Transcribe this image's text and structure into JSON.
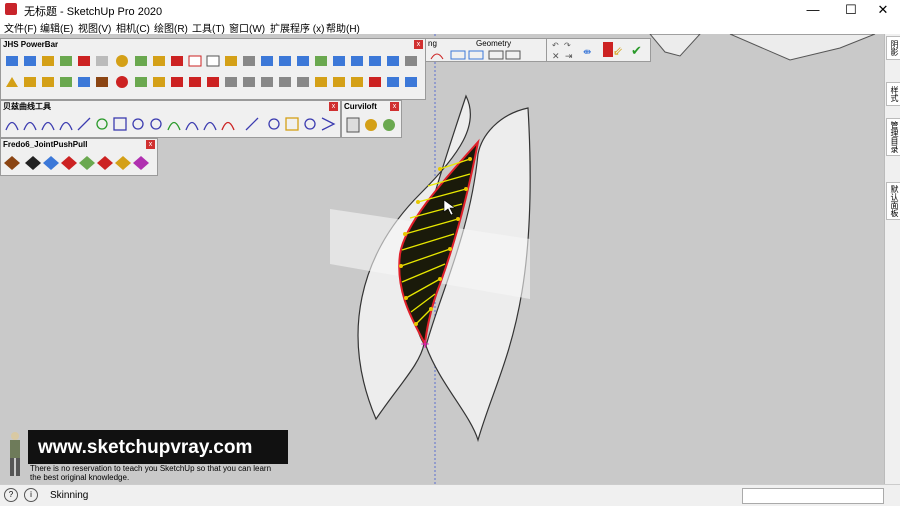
{
  "window": {
    "title": "无标题 - SketchUp Pro 2020",
    "minimize": "—",
    "maximize": "☐",
    "close": "✕"
  },
  "menu": [
    "文件(F)",
    "编辑(E)",
    "视图(V)",
    "相机(C)",
    "绘图(R)",
    "工具(T)",
    "窗口(W)",
    "扩展程序 (x)",
    "帮助(H)"
  ],
  "toolbars": {
    "powerbar": {
      "title": "JHS PowerBar"
    },
    "bezier": {
      "title": "贝兹曲线工具"
    },
    "curviloft": {
      "title": "Curviloft"
    },
    "fredo": {
      "title": "Fredo6_JointPushPull"
    },
    "partial": {
      "left_fragment": "ng"
    },
    "geometry": {
      "title": "Geometry"
    }
  },
  "tray_tabs": [
    "阴影",
    "样式",
    "管理目录",
    "默认面板"
  ],
  "watermark": {
    "url": "www.sketchupvray.com",
    "line1": "There is no reservation to teach you SketchUp so that you can learn",
    "line2": "the best original knowledge."
  },
  "status": {
    "text": "Skinning"
  },
  "colors": {
    "accent": "#d4a017",
    "highlight": "#e8e800",
    "selection": "#e0202a"
  }
}
